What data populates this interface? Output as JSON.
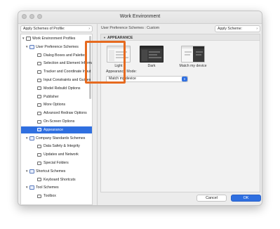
{
  "window": {
    "title": "Work Environment"
  },
  "left_pane": {
    "apply_profile_popup": "Apply Schemes of Profile:",
    "tree": [
      {
        "label": "Work Environment Profiles",
        "level": 0,
        "kind": "root",
        "icon": "profiles-icon"
      },
      {
        "label": "User Preference Schemes",
        "level": 1,
        "kind": "folder",
        "icon": "folder-icon"
      },
      {
        "label": "Dialog Boxes and Palettes",
        "level": 2,
        "kind": "item",
        "icon": "dialog-icon"
      },
      {
        "label": "Selection and Element Information",
        "level": 2,
        "kind": "item",
        "icon": "selection-icon"
      },
      {
        "label": "Tracker and Coordinate Input",
        "level": 2,
        "kind": "item",
        "icon": "tracker-icon"
      },
      {
        "label": "Input Constraints and Guides",
        "level": 2,
        "kind": "item",
        "icon": "constraints-icon"
      },
      {
        "label": "Model Rebuild Options",
        "level": 2,
        "kind": "item",
        "icon": "rebuild-icon"
      },
      {
        "label": "Publisher",
        "level": 2,
        "kind": "item",
        "icon": "publisher-icon"
      },
      {
        "label": "More Options",
        "level": 2,
        "kind": "item",
        "icon": "options-icon"
      },
      {
        "label": "Advanced Redraw Options",
        "level": 2,
        "kind": "item",
        "icon": "redraw-icon"
      },
      {
        "label": "On-Screen Options",
        "level": 2,
        "kind": "item",
        "icon": "onscreen-icon"
      },
      {
        "label": "Appearance",
        "level": 2,
        "kind": "item",
        "icon": "appearance-icon",
        "selected": true
      },
      {
        "label": "Company Standards Schemes",
        "level": 1,
        "kind": "folder",
        "icon": "folder-icon"
      },
      {
        "label": "Data Safety & Integrity",
        "level": 2,
        "kind": "item",
        "icon": "data-safety-icon"
      },
      {
        "label": "Updates and Network",
        "level": 2,
        "kind": "item",
        "icon": "network-icon"
      },
      {
        "label": "Special Folders",
        "level": 2,
        "kind": "item",
        "icon": "special-folders-icon"
      },
      {
        "label": "Shortcut Schemes",
        "level": 1,
        "kind": "folder",
        "icon": "folder-icon"
      },
      {
        "label": "Keyboard Shortcuts",
        "level": 2,
        "kind": "item",
        "icon": "keyboard-icon"
      },
      {
        "label": "Tool Schemes",
        "level": 1,
        "kind": "folder",
        "icon": "folder-icon"
      },
      {
        "label": "Toolbox",
        "level": 2,
        "kind": "item",
        "icon": "toolbox-icon"
      }
    ]
  },
  "right_pane": {
    "scheme_label": "User Preference Schemes : Custom",
    "apply_scheme_popup": "Apply Scheme:",
    "section_title": "APPEARANCE",
    "options": [
      {
        "label": "Light",
        "icon": "light-theme-thumbnail"
      },
      {
        "label": "Dark",
        "icon": "dark-theme-thumbnail",
        "selected": true
      },
      {
        "label": "Match my device",
        "icon": "auto-theme-thumbnail"
      }
    ],
    "mode_label": "Appearance Mode:",
    "mode_value": "Match my device"
  },
  "buttons": {
    "cancel": "Cancel",
    "ok": "OK"
  },
  "colors": {
    "accent": "#2f6fe0",
    "highlight": "#e66a1f"
  }
}
